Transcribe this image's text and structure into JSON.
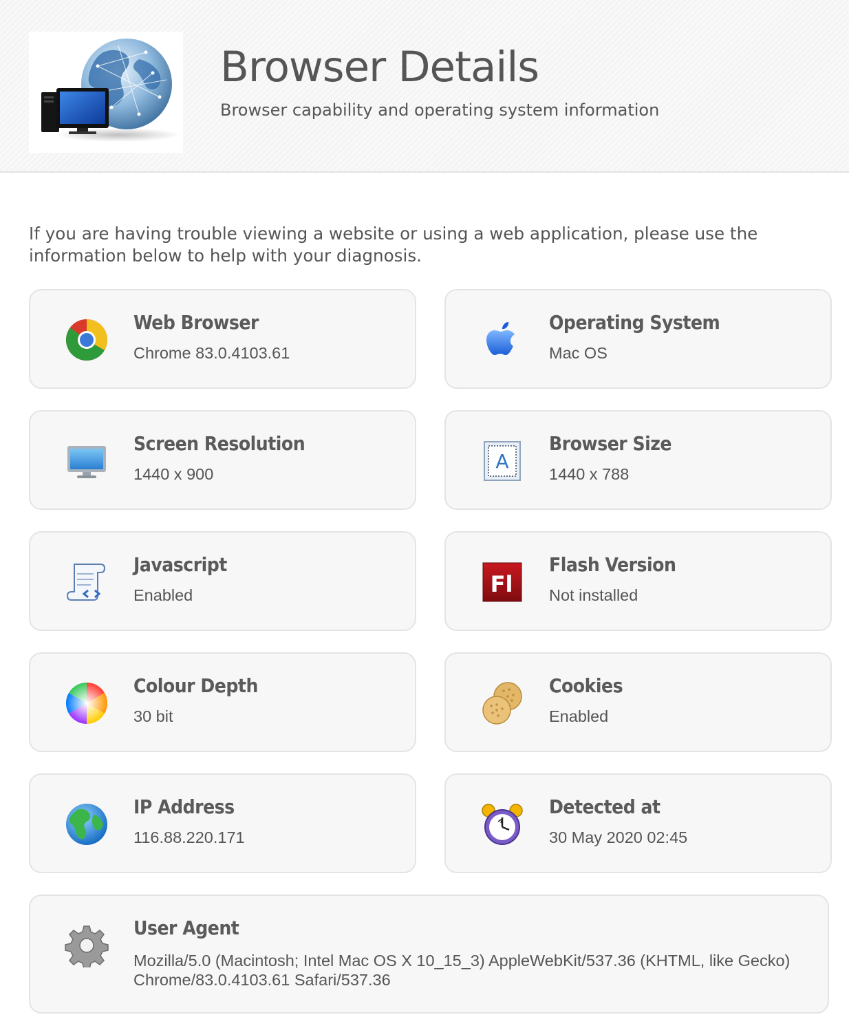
{
  "header": {
    "title": "Browser Details",
    "subtitle": "Browser capability and operating system information",
    "logo_icon": "globe-computer-icon"
  },
  "intro": "If you are having trouble viewing a website or using a web application, please use the information below to help with your diagnosis.",
  "cards": {
    "web_browser": {
      "label": "Web Browser",
      "value": "Chrome 83.0.4103.61",
      "icon": "chrome-icon"
    },
    "operating_system": {
      "label": "Operating System",
      "value": "Mac OS",
      "icon": "apple-icon"
    },
    "screen_resolution": {
      "label": "Screen Resolution",
      "value": "1440 x 900",
      "icon": "monitor-icon"
    },
    "browser_size": {
      "label": "Browser Size",
      "value": "1440 x 788",
      "icon": "browser-size-icon"
    },
    "javascript": {
      "label": "Javascript",
      "value": "Enabled",
      "icon": "script-icon"
    },
    "flash_version": {
      "label": "Flash Version",
      "value": "Not installed",
      "icon": "flash-icon"
    },
    "colour_depth": {
      "label": "Colour Depth",
      "value": "30 bit",
      "icon": "colour-wheel-icon"
    },
    "cookies": {
      "label": "Cookies",
      "value": "Enabled",
      "icon": "cookies-icon"
    },
    "ip_address": {
      "label": "IP Address",
      "value": "116.88.220.171",
      "icon": "globe-icon"
    },
    "detected_at": {
      "label": "Detected at",
      "value": "30 May 2020 02:45",
      "icon": "alarm-clock-icon"
    },
    "user_agent": {
      "label": "User Agent",
      "value": "Mozilla/5.0 (Macintosh; Intel Mac OS X 10_15_3) AppleWebKit/537.36 (KHTML, like Gecko) Chrome/83.0.4103.61 Safari/537.36",
      "icon": "gear-icon"
    }
  },
  "colors": {
    "text": "#555555",
    "card_background": "#f7f7f7",
    "card_border": "#e4e4e4"
  }
}
